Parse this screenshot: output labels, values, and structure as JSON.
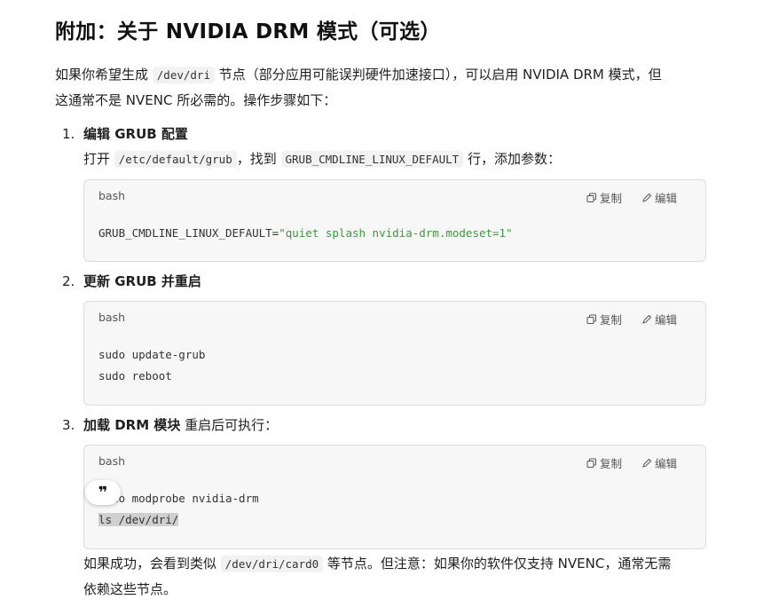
{
  "heading": "附加：关于 NVIDIA DRM 模式（可选）",
  "intro": {
    "before": "如果你希望生成 ",
    "code": "/dev/dri",
    "after_line1": " 节点（部分应用可能误判硬件加速接口），可以启用 NVIDIA DRM 模式，但",
    "line2": "这通常不是 NVENC 所必需的。操作步骤如下："
  },
  "code_actions": {
    "copy": "复制",
    "edit": "编辑"
  },
  "steps": [
    {
      "num": "1.",
      "title": "编辑 GRUB 配置",
      "desc_a": "打开 ",
      "desc_code1": "/etc/default/grub",
      "desc_b": "，找到 ",
      "desc_code2": "GRUB_CMDLINE_LINUX_DEFAULT",
      "desc_c": " 行，添加参数：",
      "code_lang": "bash",
      "code_key": "GRUB_CMDLINE_LINUX_DEFAULT=",
      "code_str": "\"quiet splash nvidia-drm.modeset=1\""
    },
    {
      "num": "2.",
      "title": "更新 GRUB 并重启",
      "code_lang": "bash",
      "lines": [
        "sudo update-grub",
        "sudo reboot"
      ]
    },
    {
      "num": "3.",
      "title": "加载 DRM 模块",
      "title_suffix": " 重启后可执行：",
      "code_lang": "bash",
      "lines": [
        "sudo modprobe nvidia-drm",
        "ls /dev/dri/"
      ]
    }
  ],
  "outro": {
    "a": "如果成功，会看到类似 ",
    "code": "/dev/dri/card0",
    "b": " 等节点。但注意：如果你的软件仅支持 NVENC，通常无需",
    "line2": "依赖这些节点。"
  },
  "quote_bubble": "❞"
}
